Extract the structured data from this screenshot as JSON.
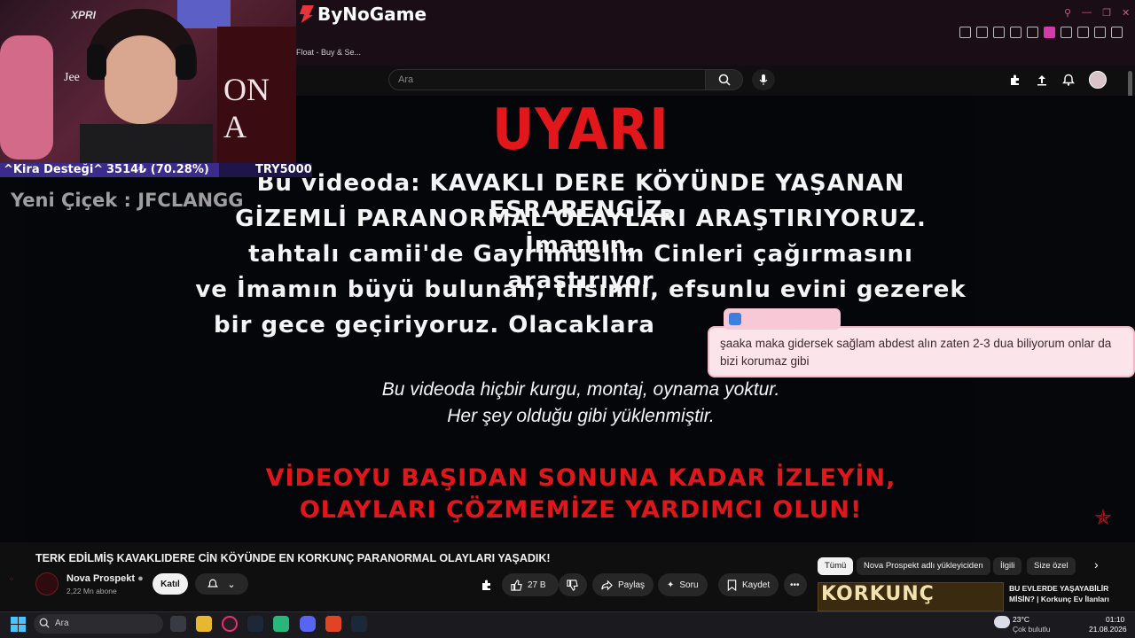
{
  "browser": {
    "logo_text": "ByNoGame",
    "tab_text": "Float - Buy & Se..."
  },
  "youtube_header": {
    "search_placeholder": "Ara"
  },
  "video": {
    "warning_title": "UYARI",
    "main_text": [
      "Bu videoda: KAVAKLI DERE KÖYÜNDE YAŞANAN ESRARENGİZ,",
      "GİZEMLİ PARANORMAL OLAYLARI ARAŞTIRIYORUZ. İmamın,",
      "tahtalı camii'de Gayrimüslim Cinleri çağırmasını araştırıyor",
      "ve İmamın büyü bulunan, tılsımlı, efsunlu evini gezerek",
      "bir gece geçiriyoruz. Olacaklara"
    ],
    "italic_text": [
      "Bu videoda hiçbir kurgu, montaj, oynama yoktur.",
      "Her şey olduğu gibi yüklenmiştir."
    ],
    "red_text": [
      "VİDEOYU BAŞIDAN SONUNA KADAR İZLEYİN,",
      "OLAYLARI ÇÖZMEMİZE YARDIMCI OLUN!"
    ],
    "trailing_text": "!"
  },
  "chat_popup": {
    "message": "şaaka maka gidersek sağlam abdest alın zaten 2-3 dua biliyorum onlar da bizi korumaz gibi"
  },
  "stream_overlay": {
    "cam_brand": "XPRI",
    "cam_name": "Jee",
    "poster_text": "ON A",
    "donation_label": "^Kira Desteği^",
    "donation_amount": "3514₺ (70.28%)",
    "donation_progress": 0.7028,
    "donation_goal": "TRY5000",
    "new_follower": "Yeni Çiçek : JFCLANGG"
  },
  "video_info": {
    "title": "TERK EDİLMİŞ KAVAKLIDERE CİN KÖYÜNDE EN KORKUNÇ PARANORMAL OLAYLARI YAŞADIK!",
    "channel_name": "Nova Prospekt",
    "subscribers": "2,22 Mn abone",
    "join_label": "Katıl",
    "likes": "27 B",
    "share_label": "Paylaş",
    "ask_label": "Soru",
    "save_label": "Kaydet"
  },
  "chips": [
    "Tümü",
    "Nova Prospekt adlı yükleyiciden",
    "İlgili",
    "Size özel"
  ],
  "recommendation": {
    "thumb_text": "KORKUNÇ",
    "title": "BU EVLERDE YAŞAYABİLİR MİSİN? | Korkunç Ev İlanları"
  },
  "taskbar": {
    "search_placeholder": "Ara",
    "weather_temp": "23°C",
    "weather_desc": "Çok bulutlu",
    "time": "01:10",
    "date": "21.08.2026"
  },
  "colors": {
    "warning_red": "#e2171b",
    "chat_bg": "#fbe5ea",
    "taskbar": "#1b1b1f"
  }
}
